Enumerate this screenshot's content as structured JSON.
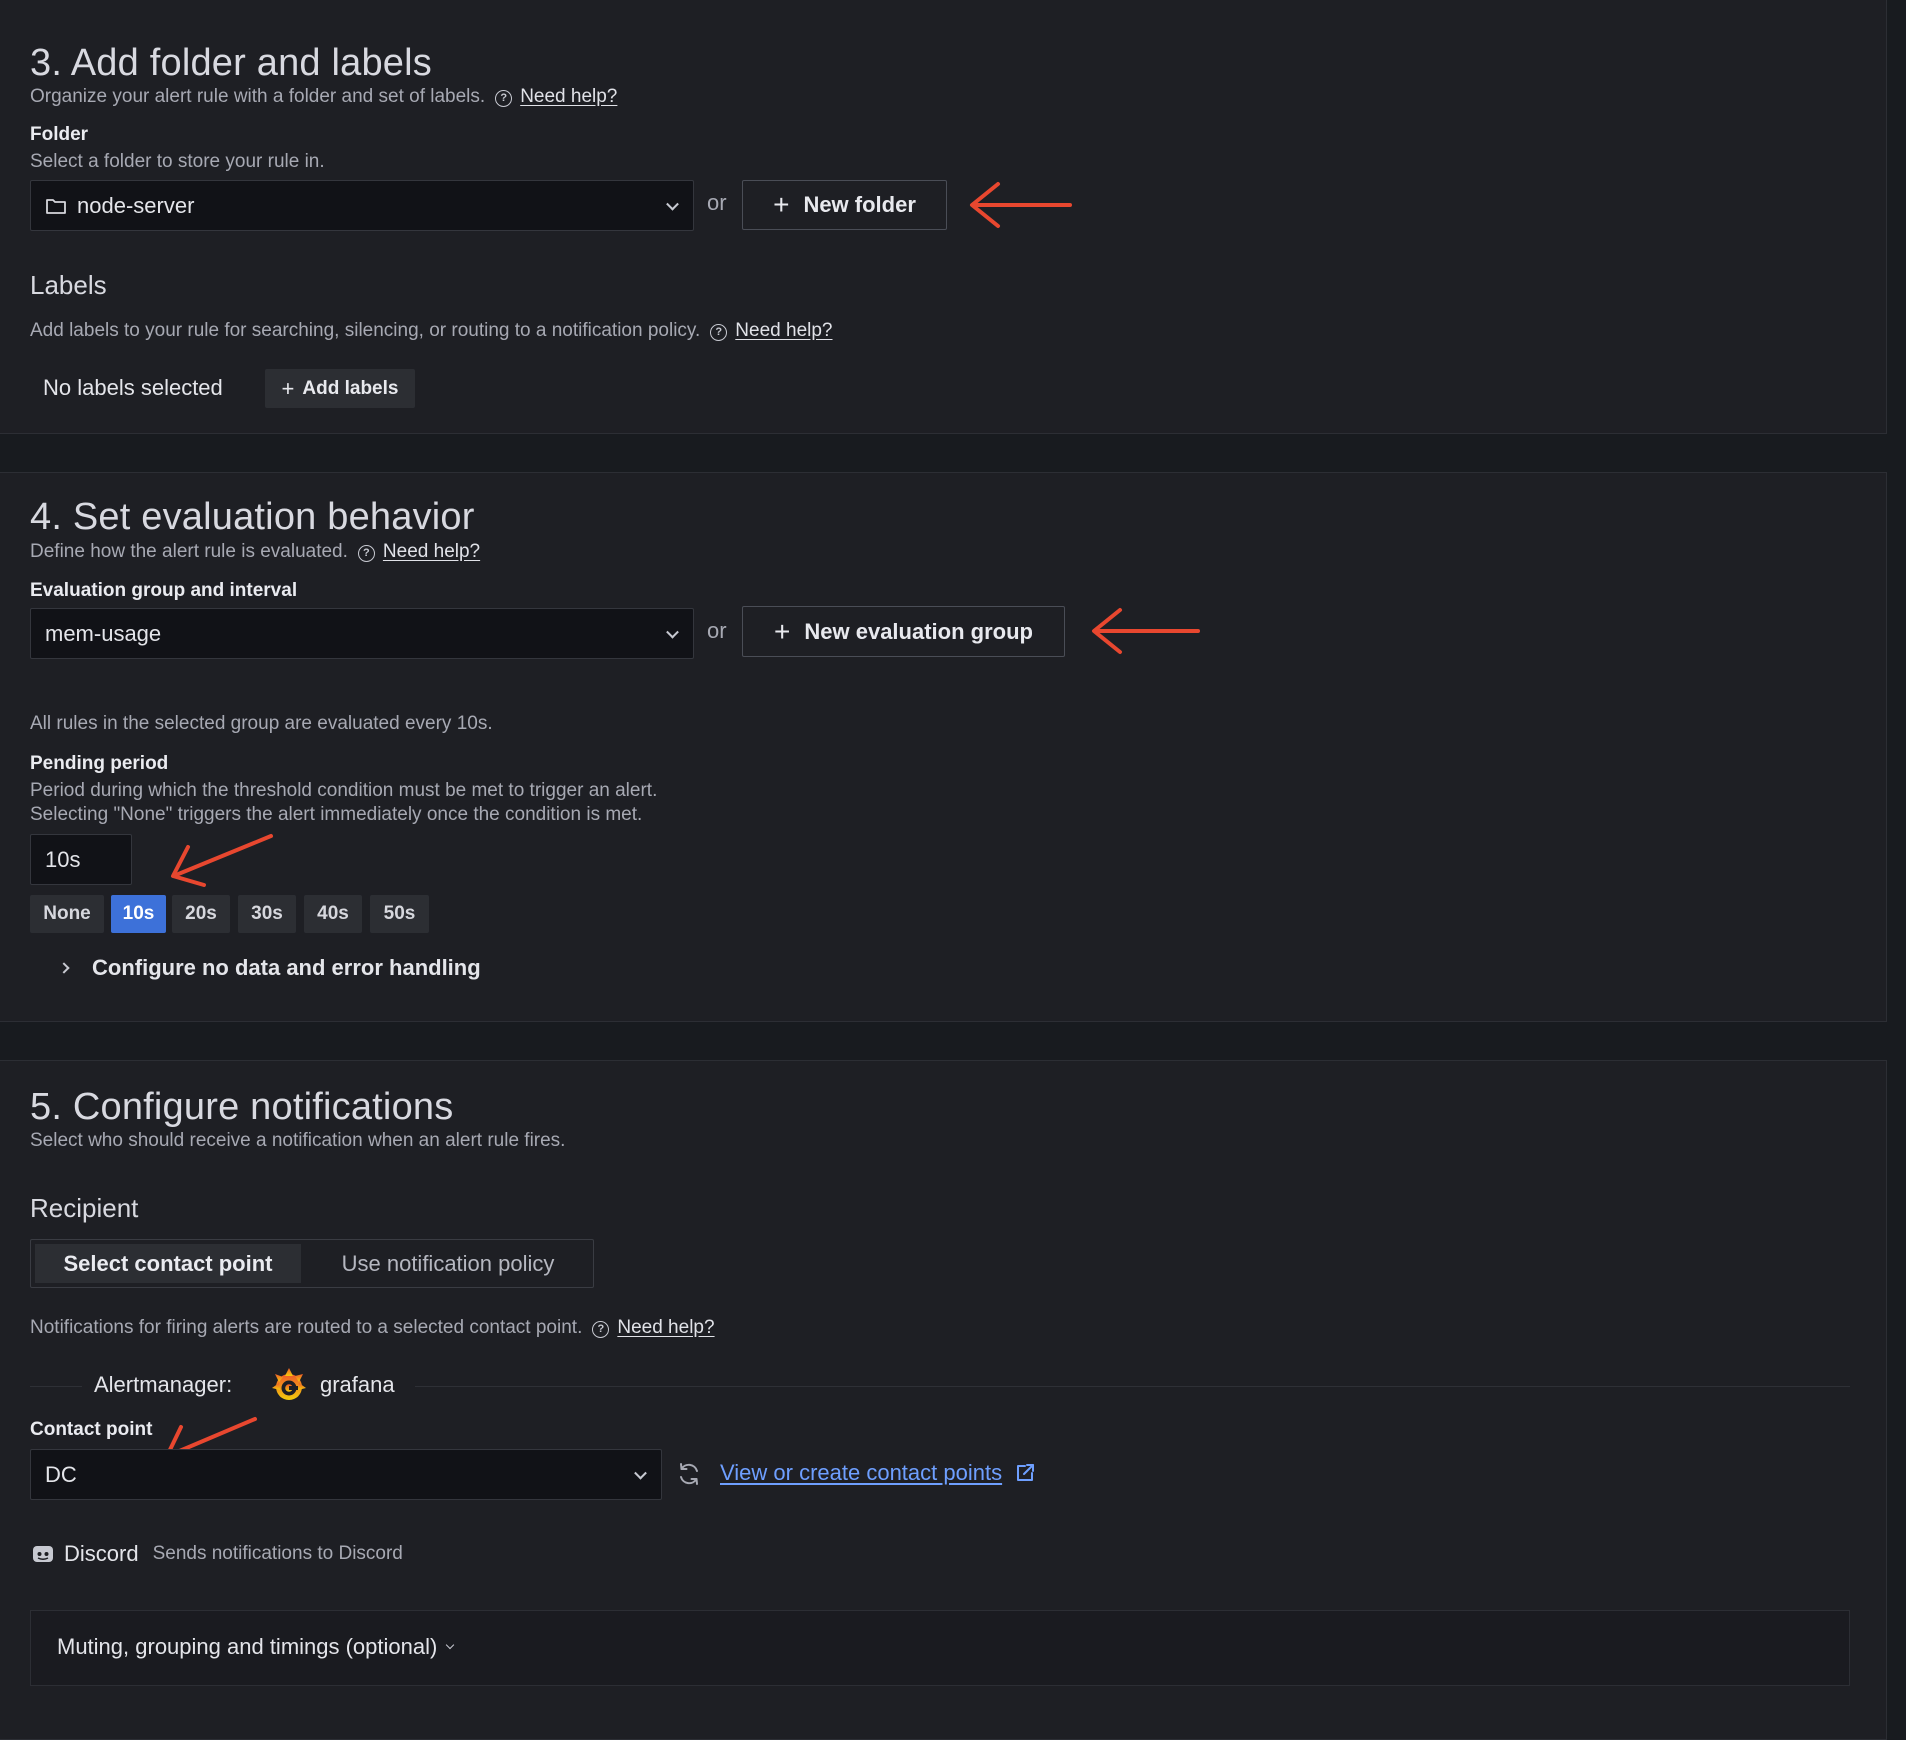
{
  "section3": {
    "title": "3. Add folder and labels",
    "description": "Organize your alert rule with a folder and set of labels.",
    "help_link": "Need help?",
    "folder_label": "Folder",
    "folder_description": "Select a folder to store your rule in.",
    "folder_value": "node-server",
    "or": "or",
    "new_folder_button": "New folder",
    "labels_title": "Labels",
    "labels_description": "Add labels to your rule for searching, silencing, or routing to a notification policy.",
    "labels_help_link": "Need help?",
    "no_labels": "No labels selected",
    "add_labels_button": "Add labels"
  },
  "section4": {
    "title": "4. Set evaluation behavior",
    "description": "Define how the alert rule is evaluated.",
    "help_link": "Need help?",
    "group_label": "Evaluation group and interval",
    "group_value": "mem-usage",
    "or": "or",
    "new_group_button": "New evaluation group",
    "interval_note": "All rules in the selected group are evaluated every 10s.",
    "pending_label": "Pending period",
    "pending_desc_1": "Period during which the threshold condition must be met to trigger an alert.",
    "pending_desc_2": "Selecting \"None\" triggers the alert immediately once the condition is met.",
    "pending_value": "10s",
    "pending_options": [
      "None",
      "10s",
      "20s",
      "30s",
      "40s",
      "50s"
    ],
    "pending_selected": "10s",
    "no_data_toggle": "Configure no data and error handling"
  },
  "section5": {
    "title": "5. Configure notifications",
    "description": "Select who should receive a notification when an alert rule fires.",
    "recipient_title": "Recipient",
    "tabs": [
      "Select contact point",
      "Use notification policy"
    ],
    "active_tab": "Select contact point",
    "routing_note": "Notifications for firing alerts are routed to a selected contact point.",
    "help_link": "Need help?",
    "alertmanager_label": "Alertmanager:",
    "alertmanager_name": "grafana",
    "contact_label": "Contact point",
    "contact_value": "DC",
    "view_link": "View or create contact points",
    "integration_name": "Discord",
    "integration_desc": "Sends notifications to Discord",
    "muting_toggle": "Muting, grouping and timings (optional)"
  },
  "icons": {
    "folder": "folder-icon",
    "help": "help-circle-icon",
    "plus": "plus-icon",
    "chevron": "chevron-down-icon",
    "refresh": "refresh-icon",
    "external": "external-link-icon",
    "discord": "discord-icon",
    "grafana": "grafana-logo-icon"
  },
  "colors": {
    "background": "#181b1f",
    "panel": "#1e1f24",
    "primary": "#3d71d9",
    "link": "#6e9fff",
    "annotation_arrow": "#e8472f"
  }
}
